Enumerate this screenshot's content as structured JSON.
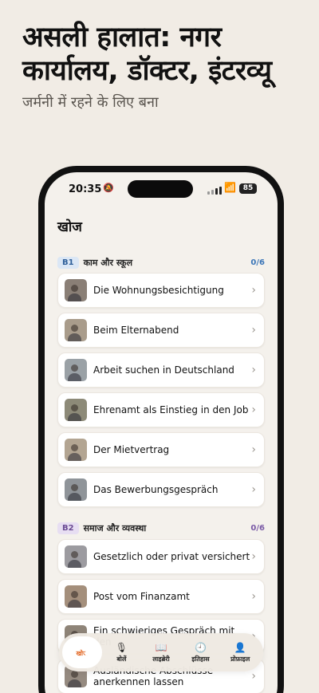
{
  "hero": {
    "title": "असली हालात: नगर कार्यालय, डॉक्टर, इंटरव्यू",
    "subtitle": "जर्मनी में रहने के लिए बना"
  },
  "status_bar": {
    "time": "20:35",
    "battery": "85"
  },
  "page": {
    "title": "खोज"
  },
  "sections": [
    {
      "level": "B1",
      "name": "काम और स्कूल",
      "progress": "0/6",
      "lessons": [
        "Die Wohnungsbesichtigung",
        "Beim Elternabend",
        "Arbeit suchen in Deutschland",
        "Ehrenamt als Einstieg in den Job",
        "Der Mietvertrag",
        "Das Bewerbungsgespräch"
      ]
    },
    {
      "level": "B2",
      "name": "समाज और व्यवस्था",
      "progress": "0/6",
      "lessons": [
        "Gesetzlich oder privat versichert",
        "Post vom Finanzamt",
        "Ein schwieriges Gespräch mit den",
        "Ausländische Abschlüsse anerkennen lassen"
      ]
    }
  ],
  "tabs": [
    {
      "label": "खोज",
      "icon": "compass-icon",
      "active": true
    },
    {
      "label": "बोलें",
      "icon": "microphone-icon",
      "active": false
    },
    {
      "label": "लाइब्रेरी",
      "icon": "book-icon",
      "active": false
    },
    {
      "label": "इतिहास",
      "icon": "clock-icon",
      "active": false
    },
    {
      "label": "प्रोफ़ाइल",
      "icon": "person-icon",
      "active": false
    }
  ],
  "colors": {
    "accent": "#e2641f",
    "b1": "#3b76b8",
    "b2": "#7a5aa6",
    "background": "#f1ece5"
  }
}
